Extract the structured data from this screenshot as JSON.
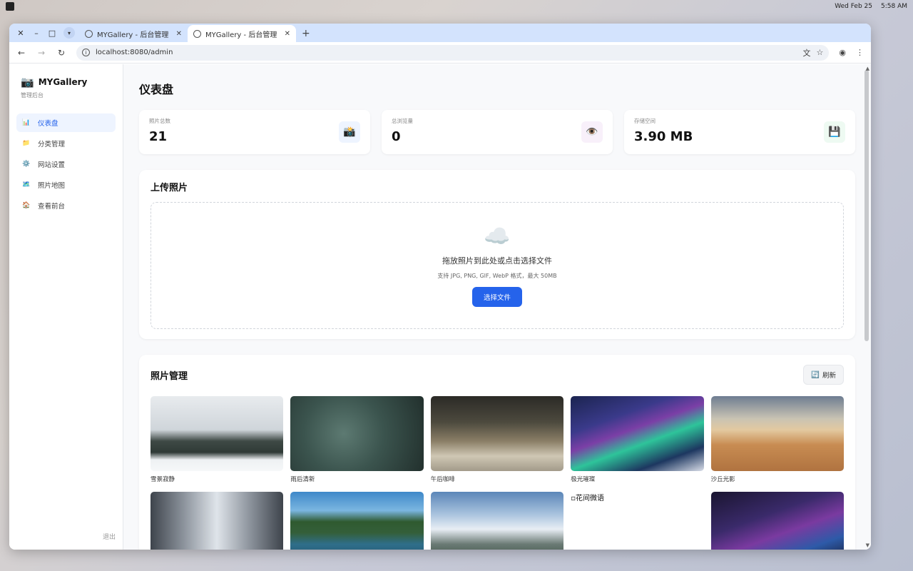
{
  "os": {
    "date": "Wed Feb 25",
    "time": "5:58 AM"
  },
  "browser": {
    "tabs": [
      {
        "title": "MYGallery - 后台管理"
      },
      {
        "title": "MYGallery - 后台管理"
      }
    ],
    "url": "localhost:8080/admin"
  },
  "sidebar": {
    "brand": "MYGallery",
    "brand_icon": "📷",
    "subtitle": "管理后台",
    "items": [
      {
        "label": "仪表盘",
        "icon": "📊"
      },
      {
        "label": "分类管理",
        "icon": "📁"
      },
      {
        "label": "网站设置",
        "icon": "⚙️"
      },
      {
        "label": "照片地图",
        "icon": "🗺️"
      },
      {
        "label": "查看前台",
        "icon": "🏠"
      }
    ],
    "logout": "退出"
  },
  "main": {
    "title": "仪表盘",
    "stats": [
      {
        "label": "照片总数",
        "value": "21",
        "icon": "📸",
        "bg": "#eef4ff"
      },
      {
        "label": "总浏览量",
        "value": "0",
        "icon": "👁️",
        "bg": "#f8f0fa"
      },
      {
        "label": "存储空间",
        "value": "3.90 MB",
        "icon": "💾",
        "bg": "#eefaf2"
      }
    ],
    "upload": {
      "title": "上传照片",
      "icon": "☁️",
      "prompt": "拖放照片到此处或点击选择文件",
      "hint": "支持 JPG, PNG, GIF, WebP 格式，最大 50MB",
      "button": "选择文件"
    },
    "photos": {
      "title": "照片管理",
      "refresh": "刷新",
      "refresh_icon": "🔄",
      "items": [
        {
          "caption": "雪景寂静"
        },
        {
          "caption": "雨后清新"
        },
        {
          "caption": "午后咖啡"
        },
        {
          "caption": "极光璀璨"
        },
        {
          "caption": "沙丘光影"
        },
        {
          "caption": ""
        },
        {
          "caption": ""
        },
        {
          "caption": ""
        },
        {
          "alt": "花间微语"
        },
        {
          "caption": ""
        }
      ]
    }
  }
}
